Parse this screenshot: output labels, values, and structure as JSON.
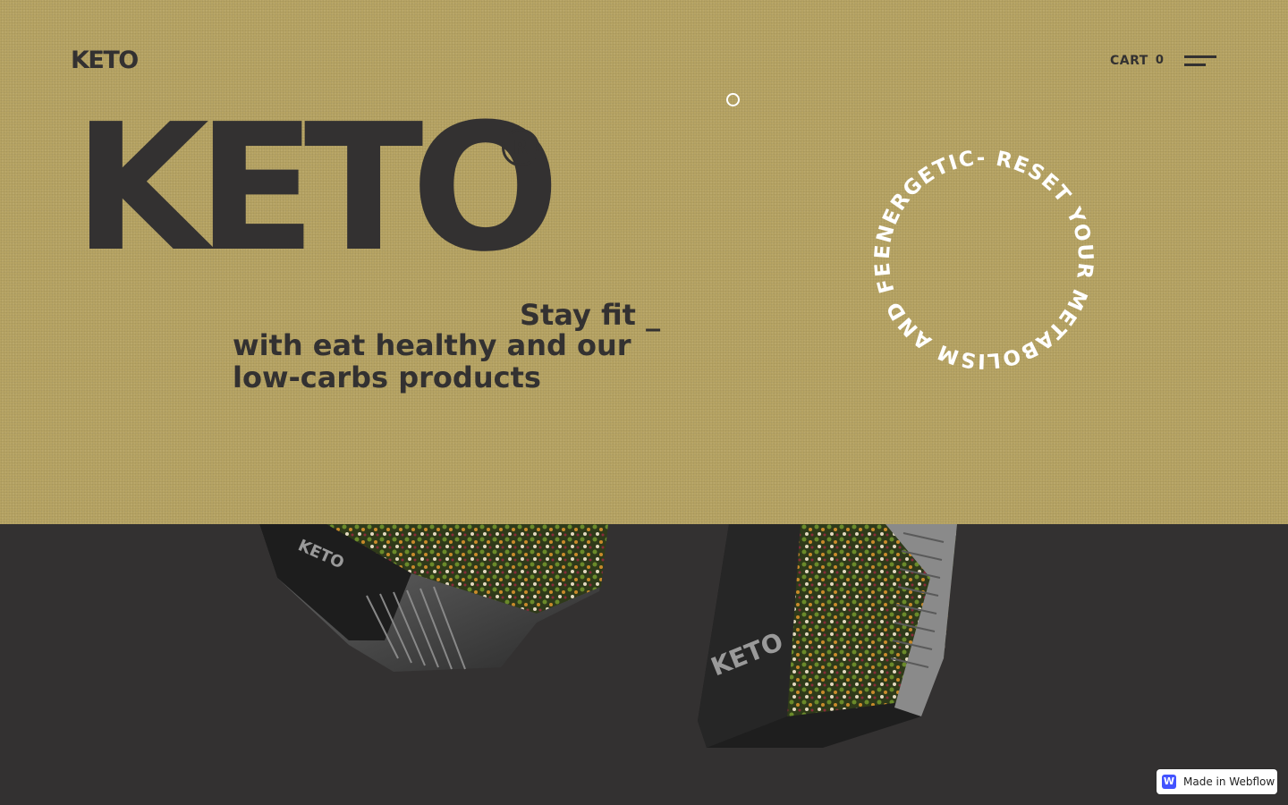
{
  "nav": {
    "logo": "KETO",
    "cart_label": "CART",
    "cart_count": "0"
  },
  "hero": {
    "title": "KETO",
    "registered_mark": "R",
    "tagline_line1": "Stay fit _",
    "tagline_line2": "with eat healthy and our low-carbs products",
    "circular_text": "ENERGETIC- RESET YOUR METABOLISM AND FEEL "
  },
  "products": {
    "package_label": "KETO"
  },
  "badge": {
    "label": "Made in Webflow",
    "icon_letter": "W"
  },
  "colors": {
    "hero_bg": "#b7a464",
    "dark_bg": "#333131",
    "text_dark": "#333131",
    "ring_text": "#ffffff",
    "webflow_blue": "#4353ff"
  }
}
